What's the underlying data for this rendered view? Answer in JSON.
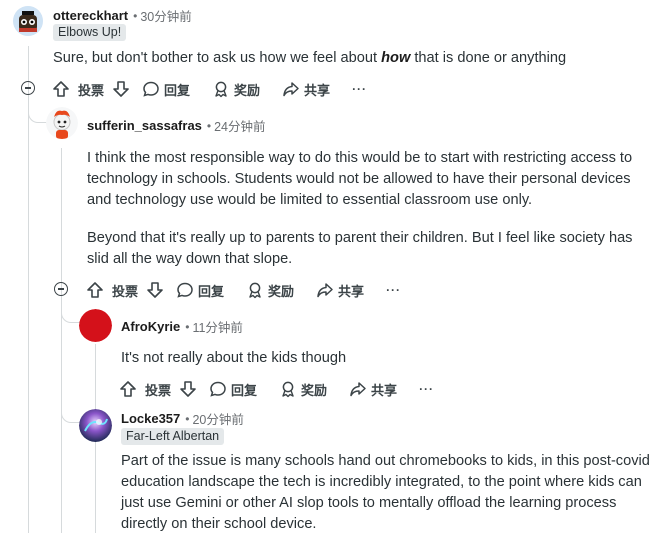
{
  "comments": [
    {
      "author": "ottereckhart",
      "time": "30分钟前",
      "flair": "Elbows Up!",
      "body_before": "Sure, but don't bother to ask us how we feel about ",
      "body_emph": "how",
      "body_after": " that is done or anything"
    },
    {
      "author": "sufferin_sassafras",
      "time": "24分钟前",
      "paragraphs": [
        "I think the most responsible way to do this would be to start with restricting access to technology in schools. Students would not be allowed to have their personal devices and technology use would be limited to essential classroom use only.",
        "Beyond that it's really up to parents to parent their children. But I feel like society has slid all the way down that slope."
      ]
    },
    {
      "author": "AfroKyrie",
      "time": "11分钟前",
      "body": "It's not really about the kids though"
    },
    {
      "author": "Locke357",
      "time": "20分钟前",
      "flair": "Far-Left Albertan",
      "body": "Part of the issue is many schools hand out chromebooks to kids, in this post-covid education landscape the tech is incredibly integrated, to the point where kids can just use Gemini or other AI slop tools to mentally offload the learning process directly on their school device."
    }
  ],
  "actions": {
    "upvote": "投票",
    "reply": "回复",
    "award": "奖励",
    "share": "共享",
    "more": "···"
  },
  "meta_separator": "•",
  "colors": {
    "avatar_afrokyrie": "#d4111a",
    "thread_line": "#d6dadc",
    "flair_bg": "#e4e8ea"
  },
  "icons": [
    "upvote-icon",
    "downvote-icon",
    "reply-icon",
    "award-icon",
    "share-icon",
    "collapse-icon",
    "more-icon"
  ]
}
